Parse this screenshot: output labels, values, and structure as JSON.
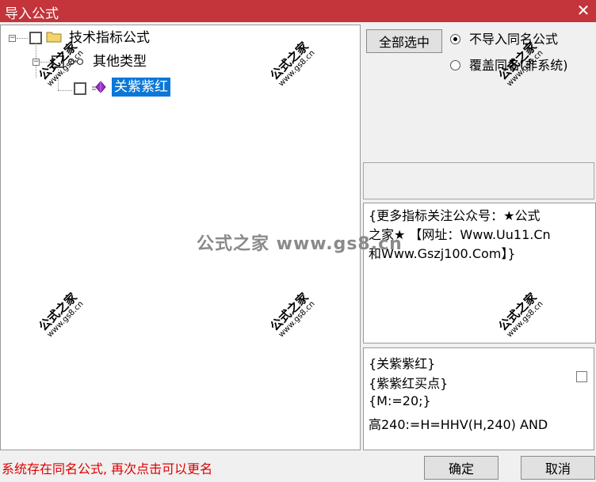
{
  "window": {
    "title": "导入公式",
    "close_glyph": "✕"
  },
  "tree": {
    "root": {
      "label": "技术指标公式",
      "expander": "⊟"
    },
    "child": {
      "label": "其他类型",
      "expander": "⊟"
    },
    "leaf": {
      "label": "关紫紫红"
    }
  },
  "options": {
    "select_all_label": "全部选中",
    "radio_skip_label": "不导入同名公式",
    "radio_overwrite_label": "覆盖同名(非系统)",
    "selected": "radio_skip"
  },
  "description": {
    "line1": "{更多指标关注公众号：★公式",
    "line2": "之家★ 【网址：Www.Uu11.Cn",
    "line3": "和Www.Gszj100.Com】}"
  },
  "code": {
    "lines": [
      "{关紫紫红}",
      "{紫紫红买点}",
      "{M:=20;}",
      "高240:=H=HHV(H,240) AND"
    ]
  },
  "status": {
    "message": "系统存在同名公式, 再次点击可以更名"
  },
  "buttons": {
    "ok_label": "确定",
    "cancel_label": "取消"
  },
  "watermark": {
    "zh": "公式之家",
    "url": "www.gs8.cn",
    "center": "公式之家 www.gs8.cn"
  },
  "colors": {
    "titlebar": "#c3353a",
    "selection": "#0a78d7",
    "status": "#e00000"
  }
}
